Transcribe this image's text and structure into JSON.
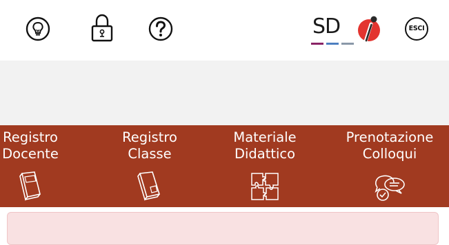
{
  "header": {
    "icons": {
      "idea": "lightbulb-icon",
      "password": "padlock-icon",
      "help": "help-icon",
      "brand": "sd-logo",
      "app": "info-i-logo",
      "logout": "logout-esci-icon"
    },
    "brand_text": "SD",
    "logout_label": "ESCI"
  },
  "menu": {
    "items": [
      {
        "line1": "Registro",
        "line2": "Docente",
        "icon": "register-book-icon"
      },
      {
        "line1": "Registro",
        "line2": "Classe",
        "icon": "register-book-icon"
      },
      {
        "line1": "Materiale",
        "line2": "Didattico",
        "icon": "puzzle-icon"
      },
      {
        "line1": "Prenotazione",
        "line2": "Colloqui",
        "icon": "chat-bubbles-icon"
      }
    ]
  },
  "colors": {
    "menu_bg": "#a13a20",
    "alert_bg": "#f9e1e2",
    "brand_red": "#e3342f"
  }
}
